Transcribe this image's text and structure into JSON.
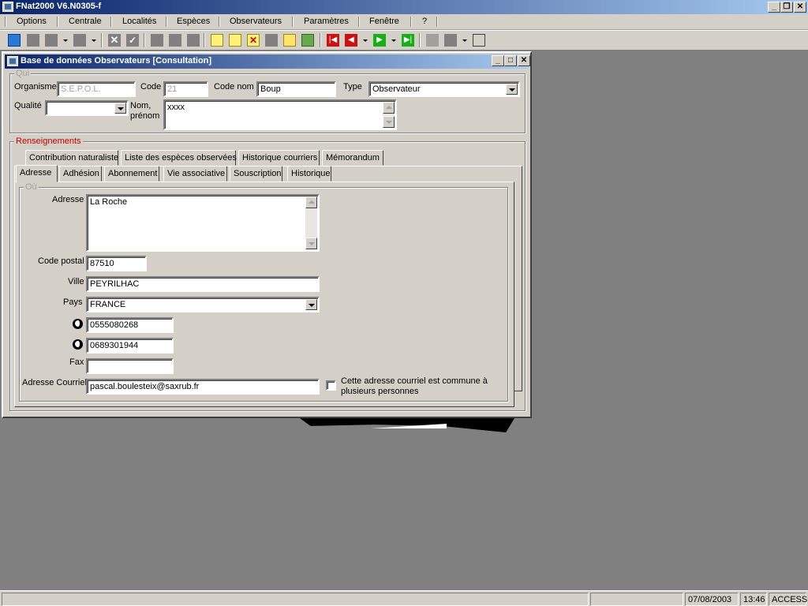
{
  "app": {
    "title": "FNat2000 V6.N0305-f"
  },
  "menu": {
    "items": [
      "Options",
      "Centrale",
      "Localités",
      "Espèces",
      "Observateurs",
      "Paramètres",
      "Fenêtre",
      "?"
    ]
  },
  "window": {
    "title": "Base de données Observateurs [Consultation]",
    "qui": {
      "group_label": "Qui",
      "organisme_label": "Organisme",
      "organisme_value": "S.E.P.O.L.",
      "code_label": "Code",
      "code_value": "21",
      "code_nom_label": "Code nom",
      "code_nom_value": "Boup",
      "type_label": "Type",
      "type_value": "Observateur",
      "qualite_label": "Qualité",
      "qualite_value": "",
      "nom_label_1": "Nom,",
      "nom_label_2": "prénom",
      "nom_value": "xxxx"
    },
    "renseignements": {
      "group_label": "Renseignements",
      "tabs_row1": [
        "Contribution naturaliste",
        "Liste des espèces observées",
        "Historique courriers",
        "Mémorandum"
      ],
      "tabs_row2": [
        "Adresse",
        "Adhésion",
        "Abonnement",
        "Vie associative",
        "Souscription",
        "Historique"
      ],
      "active_tab": "Adresse"
    },
    "ou": {
      "group_label": "Où",
      "adresse_label": "Adresse",
      "adresse_value": "La Roche",
      "code_postal_label": "Code postal",
      "code_postal_value": "87510",
      "ville_label": "Ville",
      "ville_value": "PEYRILHAC",
      "pays_label": "Pays",
      "pays_value": "FRANCE",
      "phone1_value": "0555080268",
      "phone2_value": "0689301944",
      "fax_label": "Fax",
      "fax_value": "",
      "courriel_label": "Adresse Courriel",
      "courriel_value": "pascal.boulesteix@saxrub.fr",
      "shared_checkbox_label_1": "Cette adresse courriel est commune à",
      "shared_checkbox_label_2": "plusieurs personnes",
      "shared_checked": false
    }
  },
  "status": {
    "date": "07/08/2003",
    "time": "13:46",
    "db": "ACCESS"
  },
  "colors": {
    "titlebar_start": "#0a246a",
    "titlebar_end": "#a6caf0",
    "face": "#d4d0c8",
    "desktop": "#808080",
    "group_label_red": "#c00000"
  }
}
